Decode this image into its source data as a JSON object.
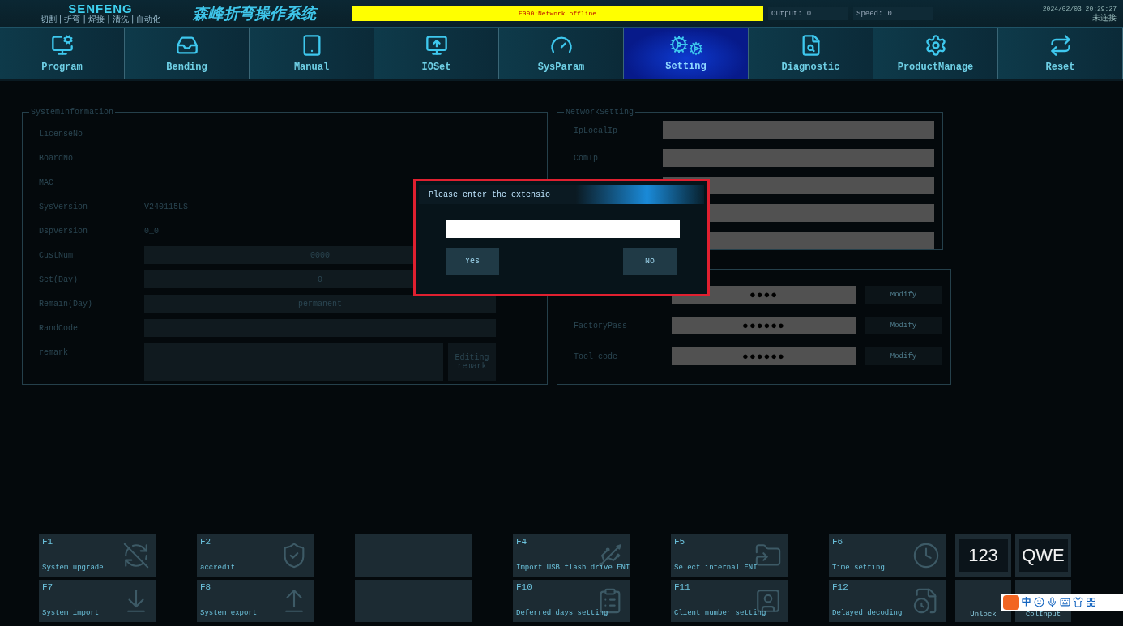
{
  "header": {
    "logo": "SENFENG",
    "logo_tagline": "切割 | 折弯 | 焊接 | 清洗 | 自动化",
    "title": "森峰折弯操作系统",
    "alarm": "E000:Network offline",
    "output_label": "Output:",
    "output_value": "0",
    "speed_label": "Speed:",
    "speed_value": "0",
    "datetime": "2024/02/03 20:29:27",
    "connection": "未连接"
  },
  "tabs": [
    {
      "label": "Program",
      "kind": "program",
      "selected": false
    },
    {
      "label": "Bending",
      "kind": "bending",
      "selected": false
    },
    {
      "label": "Manual",
      "kind": "manual",
      "selected": false
    },
    {
      "label": "IOSet",
      "kind": "ioset",
      "selected": false
    },
    {
      "label": "SysParam",
      "kind": "sysparam",
      "selected": false
    },
    {
      "label": "Setting",
      "kind": "setting",
      "selected": true
    },
    {
      "label": "Diagnostic",
      "kind": "diagnostic",
      "selected": false
    },
    {
      "label": "ProductManage",
      "kind": "product",
      "selected": false
    },
    {
      "label": "Reset",
      "kind": "reset",
      "selected": false
    }
  ],
  "system_information": {
    "title": "SystemInformation",
    "rows": [
      {
        "kind": "text",
        "label": "LicenseNo"
      },
      {
        "kind": "text",
        "label": "BoardNo"
      },
      {
        "kind": "text",
        "label": "MAC"
      },
      {
        "kind": "text",
        "label": "SysVersion",
        "value": "V240115LS"
      },
      {
        "kind": "text",
        "label": "DspVersion",
        "value": "0_0"
      },
      {
        "kind": "field",
        "label": "CustNum",
        "value": "0000"
      },
      {
        "kind": "field",
        "label": "Set(Day)",
        "value": "0"
      },
      {
        "kind": "field",
        "label": "Remain(Day)",
        "value": "permanent"
      },
      {
        "kind": "field",
        "label": "RandCode"
      },
      {
        "kind": "remark",
        "label": "remark",
        "button": "Editing remark"
      }
    ]
  },
  "network_setting": {
    "title": "NetworkSetting",
    "rows": [
      {
        "label": "IpLocalIp"
      },
      {
        "label": "ComIp"
      },
      {},
      {},
      {}
    ]
  },
  "passwords": {
    "rows": [
      {
        "value": "●●●●",
        "button": "Modify"
      },
      {
        "label": "FactoryPass",
        "value": "●●●●●●",
        "button": "Modify"
      },
      {
        "label": "Tool code",
        "value": "●●●●●●",
        "button": "Modify"
      }
    ]
  },
  "dialog": {
    "title": "Please enter the extensio",
    "yes": "Yes",
    "no": "No"
  },
  "functions": [
    {
      "kind": "upgrade",
      "key": "F1",
      "label": "System upgrade"
    },
    {
      "kind": "shield",
      "key": "F2",
      "label": "accredit"
    },
    {
      "kind": "blank"
    },
    {
      "kind": "usb",
      "key": "F4",
      "label": "Import USB flash drive ENI"
    },
    {
      "kind": "folder",
      "key": "F5",
      "label": "Select internal ENI"
    },
    {
      "kind": "clock",
      "key": "F6",
      "label": "Time setting"
    },
    {
      "kind": "import",
      "key": "F7",
      "label": "System import"
    },
    {
      "kind": "export",
      "key": "F8",
      "label": "System export"
    },
    {
      "kind": "blank"
    },
    {
      "kind": "clipboard",
      "key": "F10",
      "label": "Deferred days setting"
    },
    {
      "kind": "card",
      "key": "F11",
      "label": "Client number setting"
    },
    {
      "kind": "decode",
      "key": "F12",
      "label": "Delayed decoding"
    }
  ],
  "keyboard_buttons": [
    {
      "kind": "input",
      "label": "123"
    },
    {
      "kind": "input",
      "label": "QWE"
    },
    {
      "kind": "text",
      "label": "Unlock"
    },
    {
      "kind": "text",
      "label": "ColInput"
    }
  ],
  "ime_toolbar": {
    "mode": "中"
  }
}
